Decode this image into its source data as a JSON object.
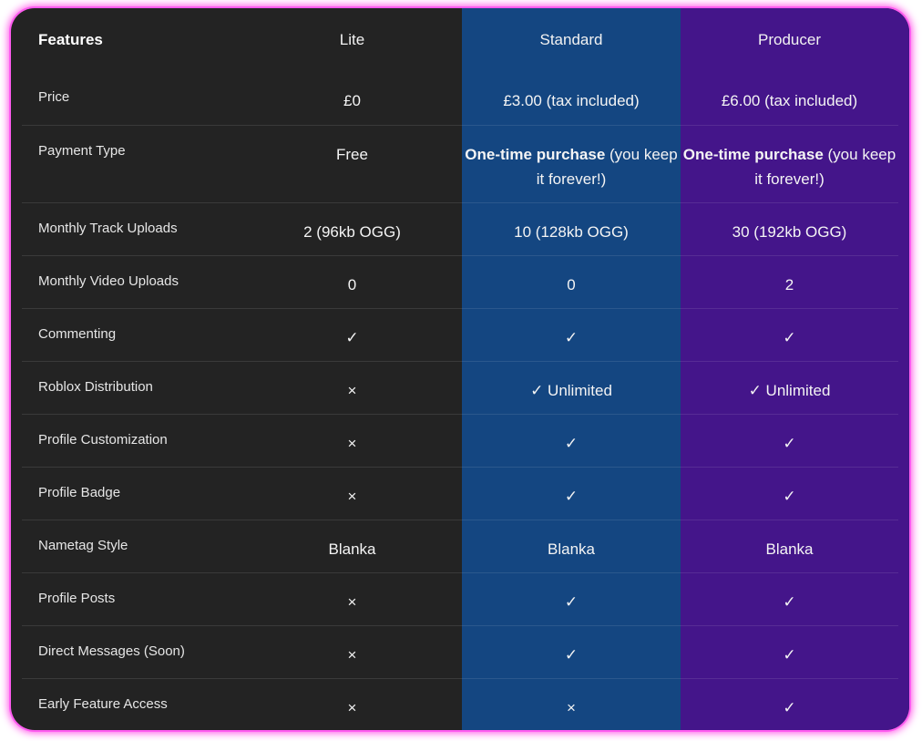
{
  "header": {
    "features": "Features",
    "plans": [
      "Lite",
      "Standard",
      "Producer"
    ]
  },
  "rows": [
    {
      "feature": "Price",
      "lite": "£0",
      "standard": "£3.00 (tax included)",
      "producer": "£6.00 (tax included)"
    },
    {
      "feature": "Payment Type",
      "lite": "Free",
      "standard_bold": "One-time purchase",
      "standard_rest": " (you keep it forever!)",
      "producer_bold": "One-time purchase",
      "producer_rest": " (you keep it forever!)"
    },
    {
      "feature": "Monthly Track Uploads",
      "lite": "2 (96kb OGG)",
      "standard": "10 (128kb OGG)",
      "producer": "30 (192kb OGG)"
    },
    {
      "feature": "Monthly Video Uploads",
      "lite": "0",
      "standard": "0",
      "producer": "2"
    },
    {
      "feature": "Commenting",
      "lite": "✓",
      "standard": "✓",
      "producer": "✓"
    },
    {
      "feature": "Roblox Distribution",
      "lite": "×",
      "standard": "✓ Unlimited",
      "producer": "✓ Unlimited"
    },
    {
      "feature": "Profile Customization",
      "lite": "×",
      "standard": "✓",
      "producer": "✓"
    },
    {
      "feature": "Profile Badge",
      "lite": "×",
      "standard": "✓",
      "producer": "✓"
    },
    {
      "feature": "Nametag Style",
      "lite": "Blanka",
      "standard": "Blanka",
      "producer": "Blanka"
    },
    {
      "feature": "Profile Posts",
      "lite": "×",
      "standard": "✓",
      "producer": "✓"
    },
    {
      "feature": "Direct Messages (Soon)",
      "lite": "×",
      "standard": "✓",
      "producer": "✓"
    },
    {
      "feature": "Early Feature Access",
      "lite": "×",
      "standard": "×",
      "producer": "✓"
    }
  ],
  "colors": {
    "background": "#232323",
    "standard_column": "#144681",
    "producer_column": "#44158a",
    "frame_glow": "#ff4fe8",
    "nametag_standard": "#5ea1ee",
    "nametag_producer": "#a77ff0"
  }
}
